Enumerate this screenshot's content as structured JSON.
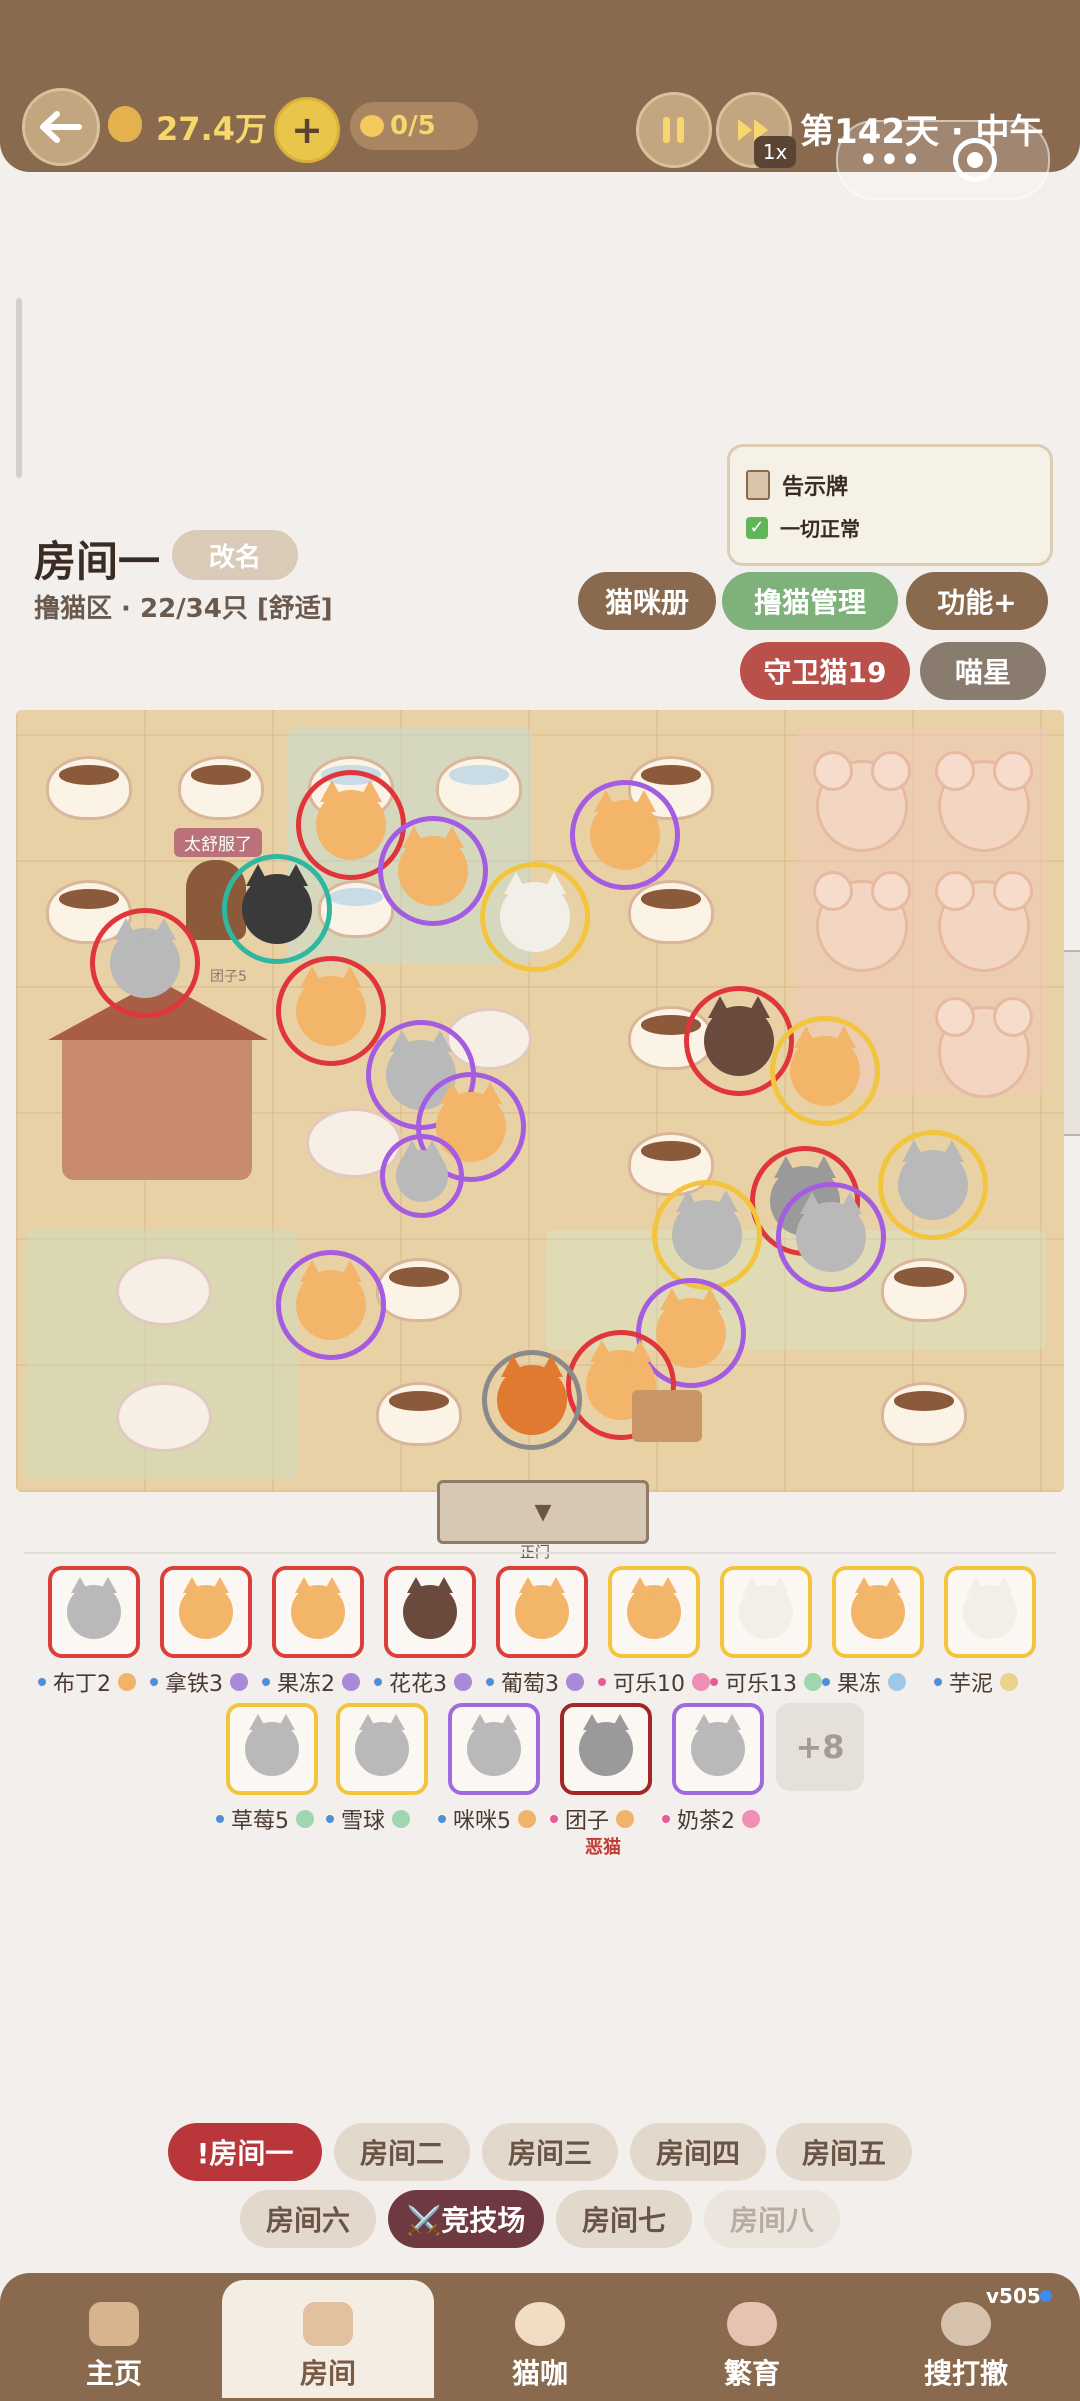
{
  "topbar": {
    "back_icon": "arrow-left-icon",
    "money": "27.4万",
    "add_label": "+",
    "cat_count": "0/5",
    "pause_icon": "pause-icon",
    "speed_label": "1x",
    "day_time": "第142天 · 中午",
    "capsule_more": "•••"
  },
  "room": {
    "title": "房间一",
    "rename": "改名",
    "subtitle": "撸猫区 · 22/34只 [舒适]"
  },
  "notice": {
    "title": "告示牌",
    "status": "一切正常"
  },
  "buttons": {
    "catbook": "猫咪册",
    "manage": "撸猫管理",
    "functions": "功能+",
    "guard": "守卫猫19",
    "meow": "喵星"
  },
  "map": {
    "bubble": "太舒服了",
    "small_label": "团子5",
    "gate_label": "正门",
    "gate_icon": "▼"
  },
  "roster": {
    "row1": [
      {
        "name": "布丁2",
        "border": "#d9403b",
        "dot": "#4f8fd6",
        "fur": "#b9b9b9",
        "mood": "#f0b36a"
      },
      {
        "name": "拿铁3",
        "border": "#d9403b",
        "dot": "#4f8fd6",
        "fur": "#f3b56a",
        "mood": "#a98ad8"
      },
      {
        "name": "果冻2",
        "border": "#d9403b",
        "dot": "#4f8fd6",
        "fur": "#f3b56a",
        "mood": "#a98ad8"
      },
      {
        "name": "花花3",
        "border": "#d9403b",
        "dot": "#4f8fd6",
        "fur": "#6b4a3e",
        "mood": "#a98ad8"
      },
      {
        "name": "葡萄3",
        "border": "#d9403b",
        "dot": "#4f8fd6",
        "fur": "#f3b56a",
        "mood": "#a98ad8"
      },
      {
        "name": "可乐10",
        "border": "#f2c53d",
        "dot": "#e85a9a",
        "fur": "#f3b56a",
        "mood": "#f08fb6"
      },
      {
        "name": "可乐13",
        "border": "#f2c53d",
        "dot": "#e85a9a",
        "fur": "#f2efe9",
        "mood": "#9fd6b0"
      },
      {
        "name": "果冻",
        "border": "#f2c53d",
        "dot": "#4f8fd6",
        "fur": "#f3b56a",
        "mood": "#9fc8e6"
      },
      {
        "name": "芋泥",
        "border": "#f2c53d",
        "dot": "#4f8fd6",
        "fur": "#f2efe9",
        "mood": "#e9d28a"
      }
    ],
    "row2": [
      {
        "name": "草莓5",
        "border": "#f2c53d",
        "dot": "#4f8fd6",
        "fur": "#b9b9b9",
        "mood": "#9fd6b0"
      },
      {
        "name": "雪球",
        "border": "#f2c53d",
        "dot": "#4f8fd6",
        "fur": "#b9b9b9",
        "mood": "#9fd6b0"
      },
      {
        "name": "咪咪5",
        "border": "#a268e0",
        "dot": "#4f8fd6",
        "fur": "#b9b9b9",
        "mood": "#f0b36a"
      },
      {
        "name": "团子",
        "border": "#a12626",
        "dot": "#e85a9a",
        "fur": "#9a9a9a",
        "mood": "#f0b36a"
      },
      {
        "name": "奶茶2",
        "border": "#a268e0",
        "dot": "#e85a9a",
        "fur": "#b9b9b9",
        "mood": "#f08fb6"
      }
    ],
    "more": "+8",
    "bad_label": "恶猫"
  },
  "rooms": {
    "tabs": [
      "!房间一",
      "房间二",
      "房间三",
      "房间四",
      "房间五",
      "房间六",
      "⚔️竞技场",
      "房间七",
      "房间八"
    ]
  },
  "nav": {
    "home": "主页",
    "room": "房间",
    "cafe": "猫咖",
    "breed": "繁育",
    "search": "搜打撤",
    "version": "v505"
  },
  "colors": {
    "accent_brown": "#8a6a4e",
    "gold": "#f7d76b",
    "green": "#7fb17a",
    "red": "#b9514a",
    "ring_red": "#e0353a",
    "ring_purple": "#a45ce0",
    "ring_yellow": "#f2c53d"
  }
}
